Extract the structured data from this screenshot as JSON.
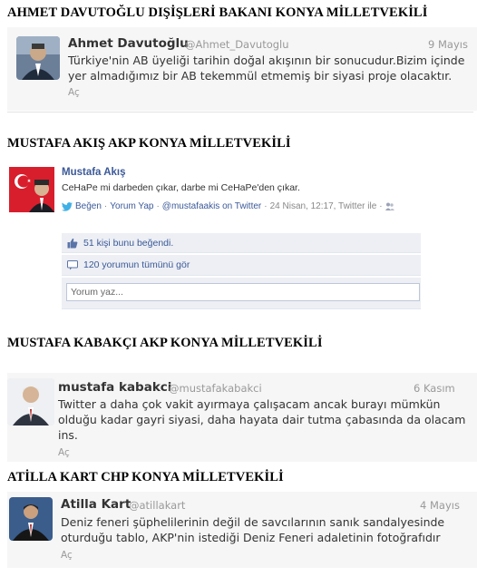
{
  "sections": [
    {
      "heading": "AHMET DAVUTOĞLU DIŞİŞLERİ BAKANI KONYA MİLLETVEKİLİ",
      "tweet": {
        "name": "Ahmet Davutoğlu",
        "handle": "@Ahmet_Davutoglu",
        "date": "9 Mayıs",
        "text": "Türkiye'nin AB üyeliği tarihin doğal akışının bir sonucudur.Bizim içinde yer almadığımız bir AB tekemmül etmemiş bir siyasi proje olacaktır.",
        "reply": "Aç"
      }
    },
    {
      "heading": "MUSTAFA AKIŞ AKP KONYA MİLLETVEKİLİ",
      "facebook": {
        "name": "Mustafa Akış",
        "text": "CeHaPe mi darbeden çıkar, darbe mi CeHaPe'den çıkar.",
        "like": "Beğen",
        "comment": "Yorum Yap",
        "source": "@mustafaakis on Twitter",
        "meta": "24 Nisan, 12:17, Twitter ile",
        "likes": "51 kişi bunu beğendi.",
        "comments": "120 yorumun tümünü gör",
        "input_placeholder": "Yorum yaz..."
      }
    },
    {
      "heading": "MUSTAFA KABAKÇI AKP KONYA MİLLETVEKİLİ",
      "tweet": {
        "name": "mustafa kabakci",
        "handle": "@mustafakabakci",
        "date": "6 Kasım",
        "text": "Twitter a daha çok vakit ayırmaya çalışacam ancak burayı mümkün olduğu kadar gayri siyasi, daha hayata dair tutma çabasında da olacam ins.",
        "reply": "Aç"
      }
    },
    {
      "heading": "ATİLLA KART CHP KONYA MİLLETVEKİLİ",
      "tweet": {
        "name": "Atilla Kart",
        "handle": "@atillakart",
        "date": "4 Mayıs",
        "text": "Deniz feneri şüphelilerinin değil de savcılarının sanık sandalyesinde oturduğu tablo, AKP'nin istediği Deniz Feneri adaletinin fotoğrafıdır",
        "reply": "Aç"
      }
    }
  ]
}
